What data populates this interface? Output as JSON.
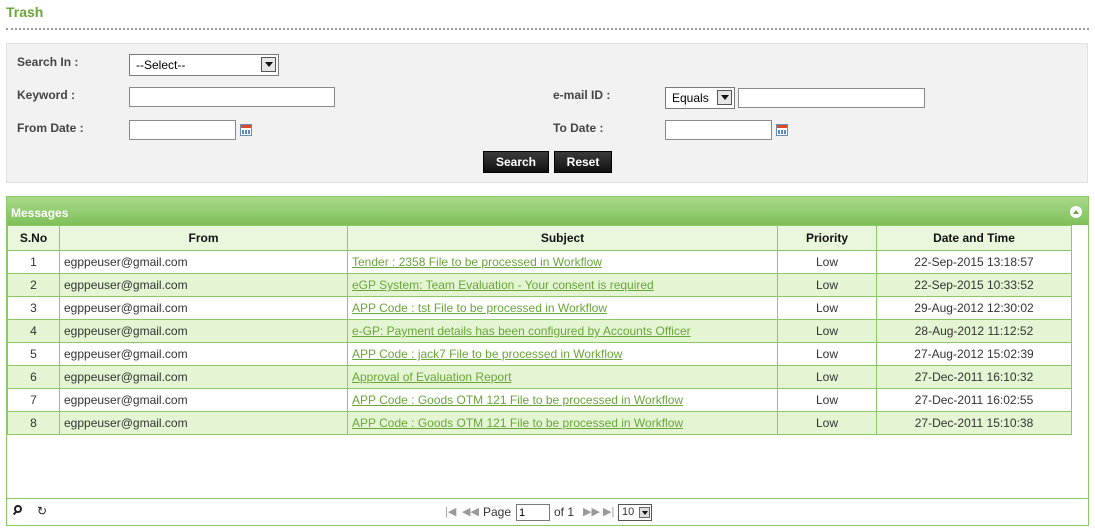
{
  "page": {
    "title": "Trash"
  },
  "search": {
    "search_in_label": "Search In :",
    "search_in_value": "--Select--",
    "keyword_label": "Keyword :",
    "keyword_value": "",
    "email_label": "e-mail ID :",
    "email_operator": "Equals",
    "email_value": "",
    "from_date_label": "From Date :",
    "from_date_value": "",
    "to_date_label": "To Date :",
    "to_date_value": "",
    "search_button": "Search",
    "reset_button": "Reset"
  },
  "grid": {
    "caption": "Messages",
    "columns": [
      "S.No",
      "From",
      "Subject",
      "Priority",
      "Date and Time"
    ],
    "rows": [
      {
        "sno": "1",
        "from": "egppeuser@gmail.com",
        "subject": "Tender : 2358 File to be processed in Workflow",
        "priority": "Low",
        "datetime": "22-Sep-2015 13:18:57"
      },
      {
        "sno": "2",
        "from": "egppeuser@gmail.com",
        "subject": "eGP System: Team Evaluation - Your consent is required",
        "priority": "Low",
        "datetime": "22-Sep-2015 10:33:52"
      },
      {
        "sno": "3",
        "from": "egppeuser@gmail.com",
        "subject": "APP Code : tst File to be processed in Workflow",
        "priority": "Low",
        "datetime": "29-Aug-2012 12:30:02"
      },
      {
        "sno": "4",
        "from": "egppeuser@gmail.com",
        "subject": "e-GP: Payment details has been configured by Accounts Officer",
        "priority": "Low",
        "datetime": "28-Aug-2012 11:12:52"
      },
      {
        "sno": "5",
        "from": "egppeuser@gmail.com",
        "subject": "APP Code : jack7 File to be processed in Workflow",
        "priority": "Low",
        "datetime": "27-Aug-2012 15:02:39"
      },
      {
        "sno": "6",
        "from": "egppeuser@gmail.com",
        "subject": "Approval of Evaluation Report",
        "priority": "Low",
        "datetime": "27-Dec-2011 16:10:32"
      },
      {
        "sno": "7",
        "from": "egppeuser@gmail.com",
        "subject": "APP Code : Goods OTM 121 File to be processed in Workflow",
        "priority": "Low",
        "datetime": "27-Dec-2011 16:02:55"
      },
      {
        "sno": "8",
        "from": "egppeuser@gmail.com",
        "subject": "APP Code : Goods OTM 121 File to be processed in Workflow",
        "priority": "Low",
        "datetime": "27-Dec-2011 15:10:38"
      }
    ]
  },
  "pager": {
    "page_label": "Page",
    "page_value": "1",
    "of_label": "of 1",
    "rows_per_page": "10"
  },
  "icons": {
    "collapse": "collapse-up-icon",
    "calendar": "calendar-icon",
    "search": "search-icon",
    "refresh": "refresh-icon"
  },
  "colors": {
    "accent": "#6aa53a",
    "header_green": "#7ec05a",
    "row_alt": "#e3f5d2"
  }
}
